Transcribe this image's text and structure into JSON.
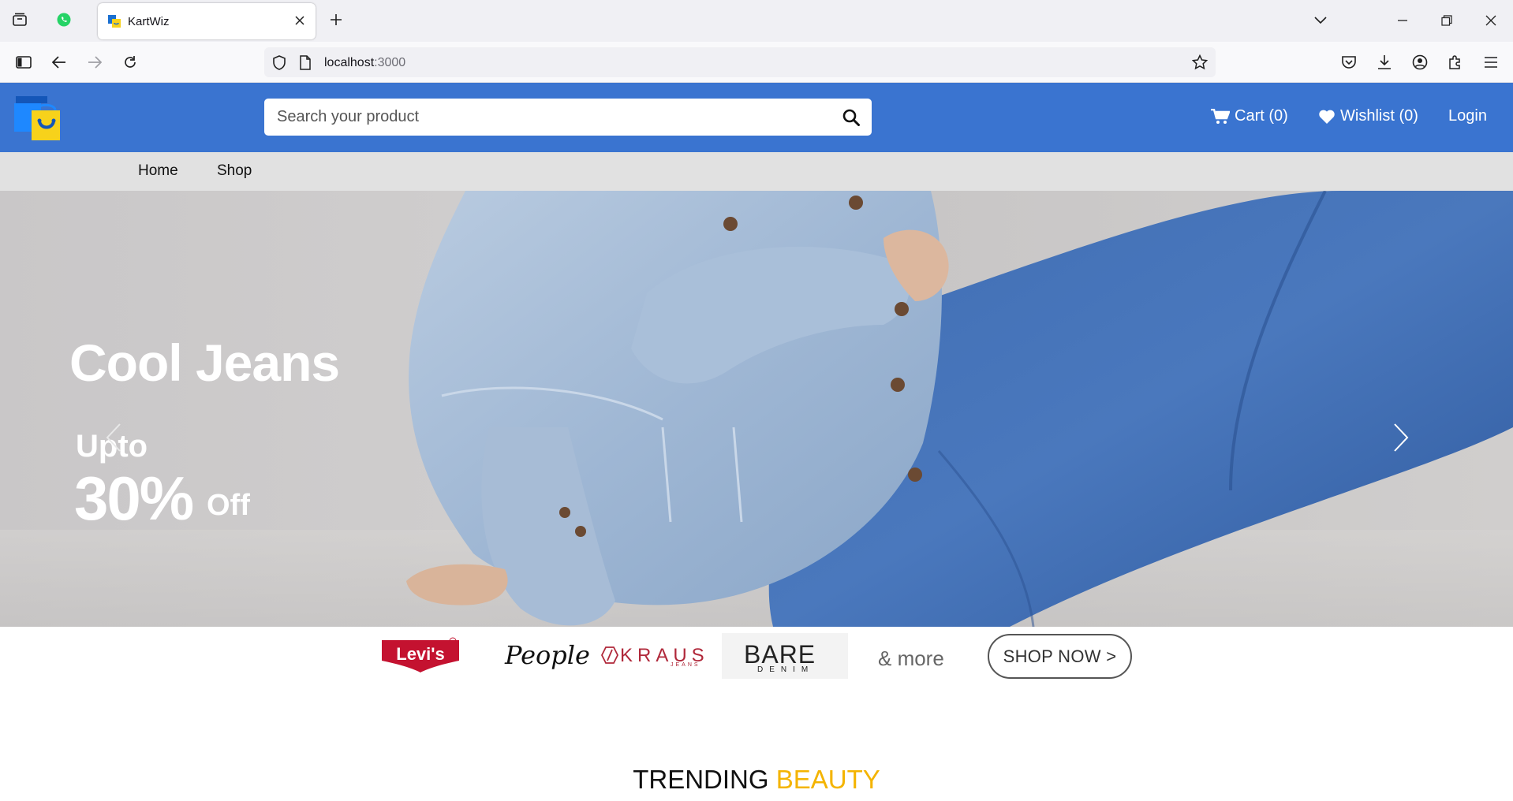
{
  "browser": {
    "tab_title": "KartWiz",
    "url_host": "localhost",
    "url_port": ":3000"
  },
  "header": {
    "search_placeholder": "Search your product",
    "cart_label": "Cart (0)",
    "wishlist_label": "Wishlist (0)",
    "login_label": "Login"
  },
  "menu": {
    "items": [
      {
        "label": "Home"
      },
      {
        "label": "Shop"
      }
    ]
  },
  "hero": {
    "title": "Cool Jeans",
    "upto": "Upto",
    "percent": "30%",
    "off": "Off"
  },
  "brands": {
    "levis": "Levi's",
    "people": "People",
    "kraus": "KRAUS",
    "kraus_sub": "JEANS",
    "bare": "BARE",
    "bare_sub": "DENIM",
    "more": "& more",
    "shop_now": "SHOP NOW >"
  },
  "section": {
    "trending_1": "TRENDING",
    "trending_2": "BEAUTY"
  },
  "colors": {
    "header_blue": "#3a74d0",
    "menu_gray": "#e1e1e1",
    "accent_yellow": "#f4b400",
    "levis_red": "#c41230",
    "kraus_red": "#b0283a"
  }
}
